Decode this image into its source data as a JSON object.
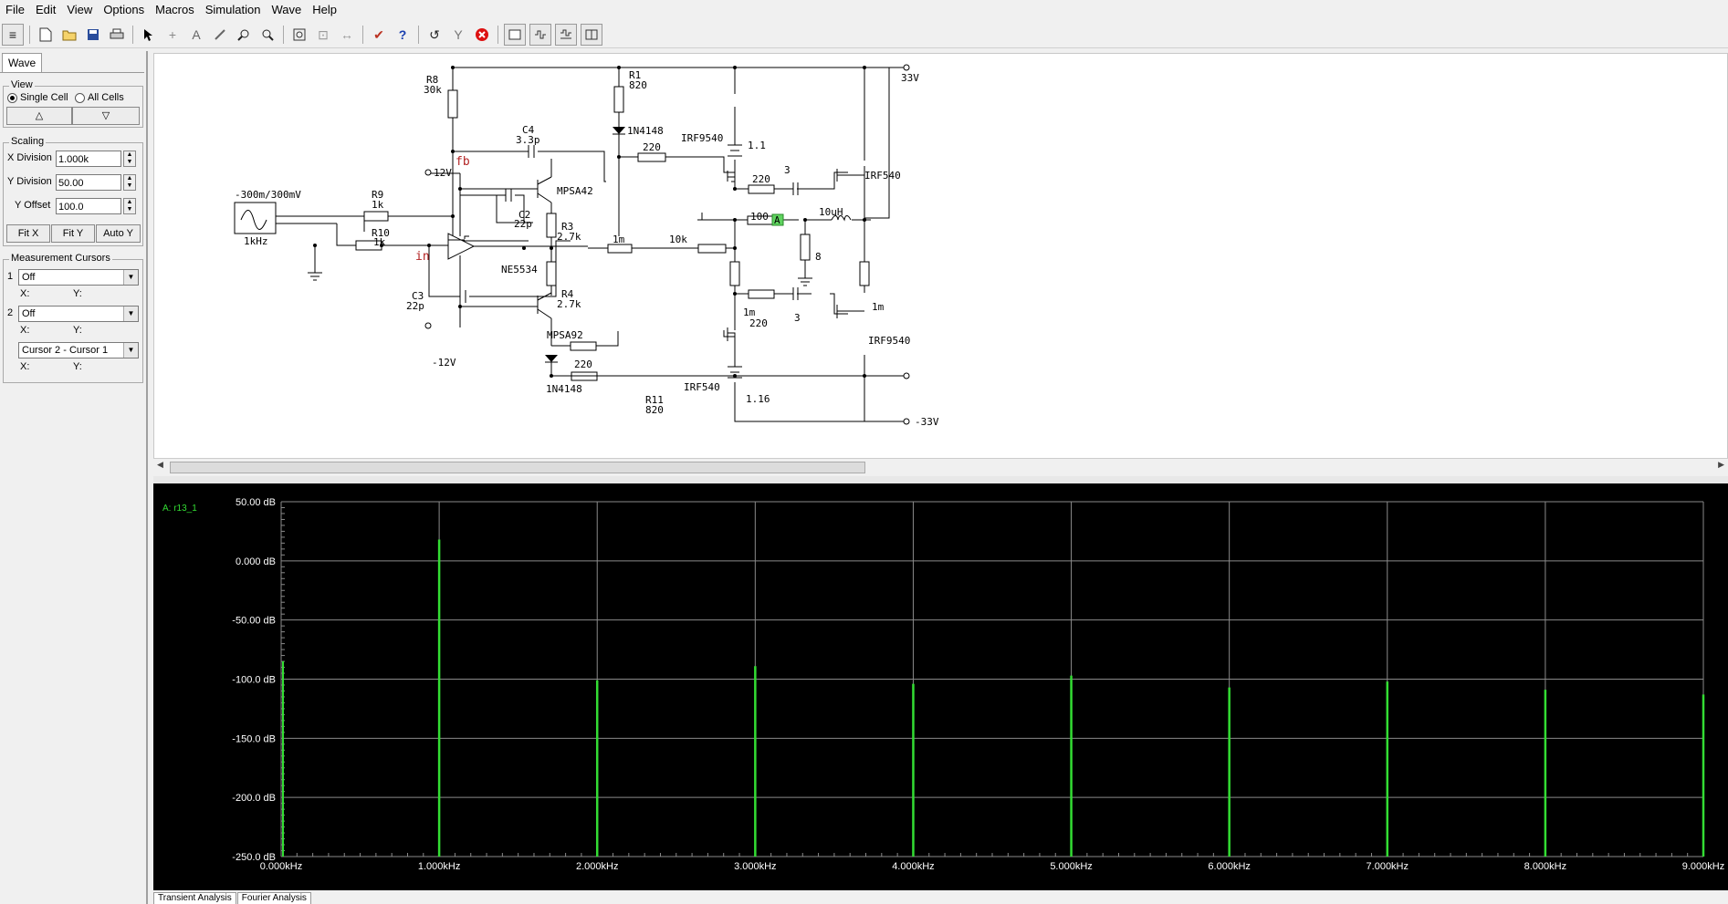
{
  "menu": [
    "File",
    "Edit",
    "View",
    "Options",
    "Macros",
    "Simulation",
    "Wave",
    "Help"
  ],
  "toolbar": {
    "icons": [
      "layers-icon",
      "new-file-icon",
      "open-folder-icon",
      "save-icon",
      "print-icon",
      "pointer-icon",
      "crosshair-icon",
      "text-tool-icon",
      "probe-icon",
      "zoom-area-icon",
      "zoom-icon",
      "zoom-fit-icon",
      "zoom-extents-icon",
      "pan-icon",
      "swap-icon",
      "check-icon",
      "help-icon",
      "undo-icon",
      "tool-icon",
      "stop-icon",
      "window-icon",
      "waveform-icon",
      "multi-wave-icon",
      "split-icon"
    ],
    "help_glyph": "?"
  },
  "left_panel": {
    "tab": "Wave",
    "view": {
      "title": "View",
      "single_cell": "Single Cell",
      "all_cells": "All Cells",
      "up": "△",
      "down": "▽"
    },
    "scaling": {
      "title": "Scaling",
      "x_division_label": "X Division",
      "x_division": "1.000k",
      "y_division_label": "Y Division",
      "y_division": "50.00",
      "y_offset_label": "Y Offset",
      "y_offset": "100.0",
      "fit_x": "Fit X",
      "fit_y": "Fit Y",
      "auto_y": "Auto Y"
    },
    "cursors": {
      "title": "Measurement Cursors",
      "c1_num": "1",
      "c1_value": "Off",
      "c2_num": "2",
      "c2_value": "Off",
      "diff_value": "Cursor 2 - Cursor 1",
      "x_label": "X:",
      "y_label": "Y:"
    }
  },
  "schematic": {
    "r8": "R8",
    "r8v": "30k",
    "r1": "R1",
    "r1v": "820",
    "d1": "1N4148",
    "c4": "C4",
    "c4v": "3.3p",
    "r220a": "220",
    "irf9540a": "IRF9540",
    "bat1": "1.1",
    "v33": "33V",
    "fb": "fb",
    "v12": "12V",
    "r220b": "220",
    "c3u": "3",
    "irf540a": "IRF540",
    "src": "-300m/300mV",
    "srcf": "1kHz",
    "r9": "R9",
    "r9v": "1k",
    "mpsa42": "MPSA42",
    "c2": "C2",
    "c2v": "22p",
    "r3": "R3",
    "r3v": "2.7k",
    "r100": "100",
    "probe": "A",
    "l1": "10uH",
    "r10": "R10",
    "r10v": "1k",
    "in": "in",
    "r1m": "1m",
    "r10k": "10k",
    "r8ohm": "8",
    "ne5534": "NE5534",
    "c3": "C3",
    "c3v": "22p",
    "r4": "R4",
    "r4v": "2.7k",
    "r1mb": "1m",
    "r220c": "220",
    "c3l": "3",
    "r1mc": "1m",
    "mpsa92": "MPSA92",
    "irf9540b": "IRF9540",
    "vm12": "-12V",
    "r220d": "220",
    "d2": "1N4148",
    "irf540b": "IRF540",
    "bat2": "1.16",
    "r11": "R11",
    "r11v": "820",
    "vm33": "-33V"
  },
  "plot": {
    "trace_label": "A: r13_1",
    "trace_color": "#33dd33"
  },
  "chart_data": {
    "type": "line",
    "title": "",
    "trace": "A: r13_1",
    "xlabel": "",
    "ylabel": "",
    "xlim": [
      0,
      9000
    ],
    "ylim": [
      -250,
      50
    ],
    "x_ticks": [
      "0.000kHz",
      "1.000kHz",
      "2.000kHz",
      "3.000kHz",
      "4.000kHz",
      "5.000kHz",
      "6.000kHz",
      "7.000kHz",
      "8.000kHz",
      "9.000kHz"
    ],
    "y_ticks": [
      "50.00 dB",
      "0.000 dB",
      "-50.00 dB",
      "-100.0 dB",
      "-150.0 dB",
      "-200.0 dB",
      "-250.0 dB"
    ],
    "series": [
      {
        "x": [
          1000,
          2000,
          3000,
          4000,
          5000,
          6000,
          7000,
          8000,
          9000
        ],
        "values": [
          18,
          -101,
          -89,
          -104,
          -97,
          -107,
          -102,
          -109,
          -113
        ]
      }
    ],
    "grid": true
  },
  "bottom_tabs": [
    "Transient Analysis",
    "Fourier Analysis"
  ]
}
